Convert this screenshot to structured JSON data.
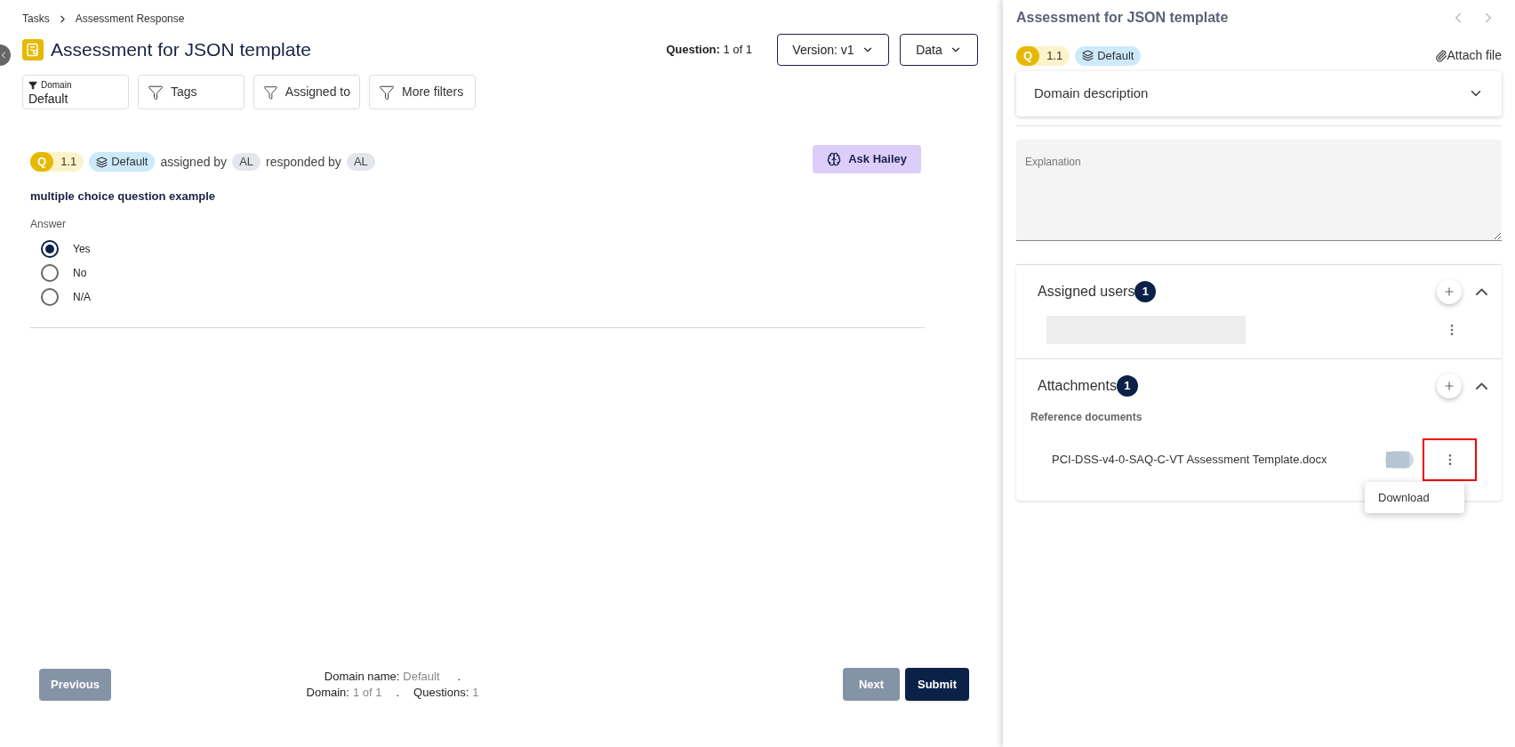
{
  "breadcrumb": [
    {
      "label": "Tasks"
    },
    {
      "label": "Assessment Response"
    }
  ],
  "title": "Assessment for JSON template",
  "question_counter": {
    "label": "Question:",
    "value": "1 of 1"
  },
  "header_buttons": [
    "Version: v1",
    "Data"
  ],
  "filters": [
    {
      "kind": "select",
      "label": "Domain",
      "value": "Default"
    },
    {
      "kind": "filter",
      "label": "Tags"
    },
    {
      "kind": "filter",
      "label": "Assigned to"
    },
    {
      "kind": "filter",
      "label": "More filters"
    }
  ],
  "question": {
    "badge": "Q",
    "number": "1.1",
    "domain": "Default",
    "assigned_label": "assigned by",
    "assigned_by": "AL",
    "responded_label": "responded by",
    "responded_by": "AL",
    "ask_button": "Ask Hailey",
    "text": "multiple choice question example",
    "answer_label": "Answer",
    "options": [
      {
        "label": "Yes",
        "selected": true
      },
      {
        "label": "No",
        "selected": false
      },
      {
        "label": "N/A",
        "selected": false
      }
    ]
  },
  "footer": {
    "previous": {
      "label": "Previous",
      "disabled": true
    },
    "next": {
      "label": "Next",
      "disabled": true
    },
    "submit": {
      "label": "Submit",
      "disabled": false
    },
    "domain_name_label": "Domain name:",
    "domain_name": "Default",
    "domain_name_dot": ".",
    "domain_label": "Domain:",
    "domain_value": "1 of 1",
    "domain_dot": ".",
    "questions_label": "Questions:",
    "questions_value": "1"
  },
  "panel": {
    "title": "Assessment for JSON template",
    "badge": "Q",
    "number": "1.1",
    "domain": "Default",
    "attach": "Attach file",
    "domain_description": {
      "label": "Domain description",
      "expanded": false
    },
    "explanation": {
      "placeholder": "Explanation"
    },
    "assigned_users": {
      "label": "Assigned users",
      "count": "1",
      "expanded": true
    },
    "attachments": {
      "label": "Attachments",
      "count": "1",
      "expanded": true,
      "group": "Reference documents",
      "files": [
        {
          "name": "PCI-DSS-v4-0-SAQ-C-VT Assessment Template.docx",
          "on": false
        }
      ]
    },
    "menu": [
      "Download"
    ]
  }
}
